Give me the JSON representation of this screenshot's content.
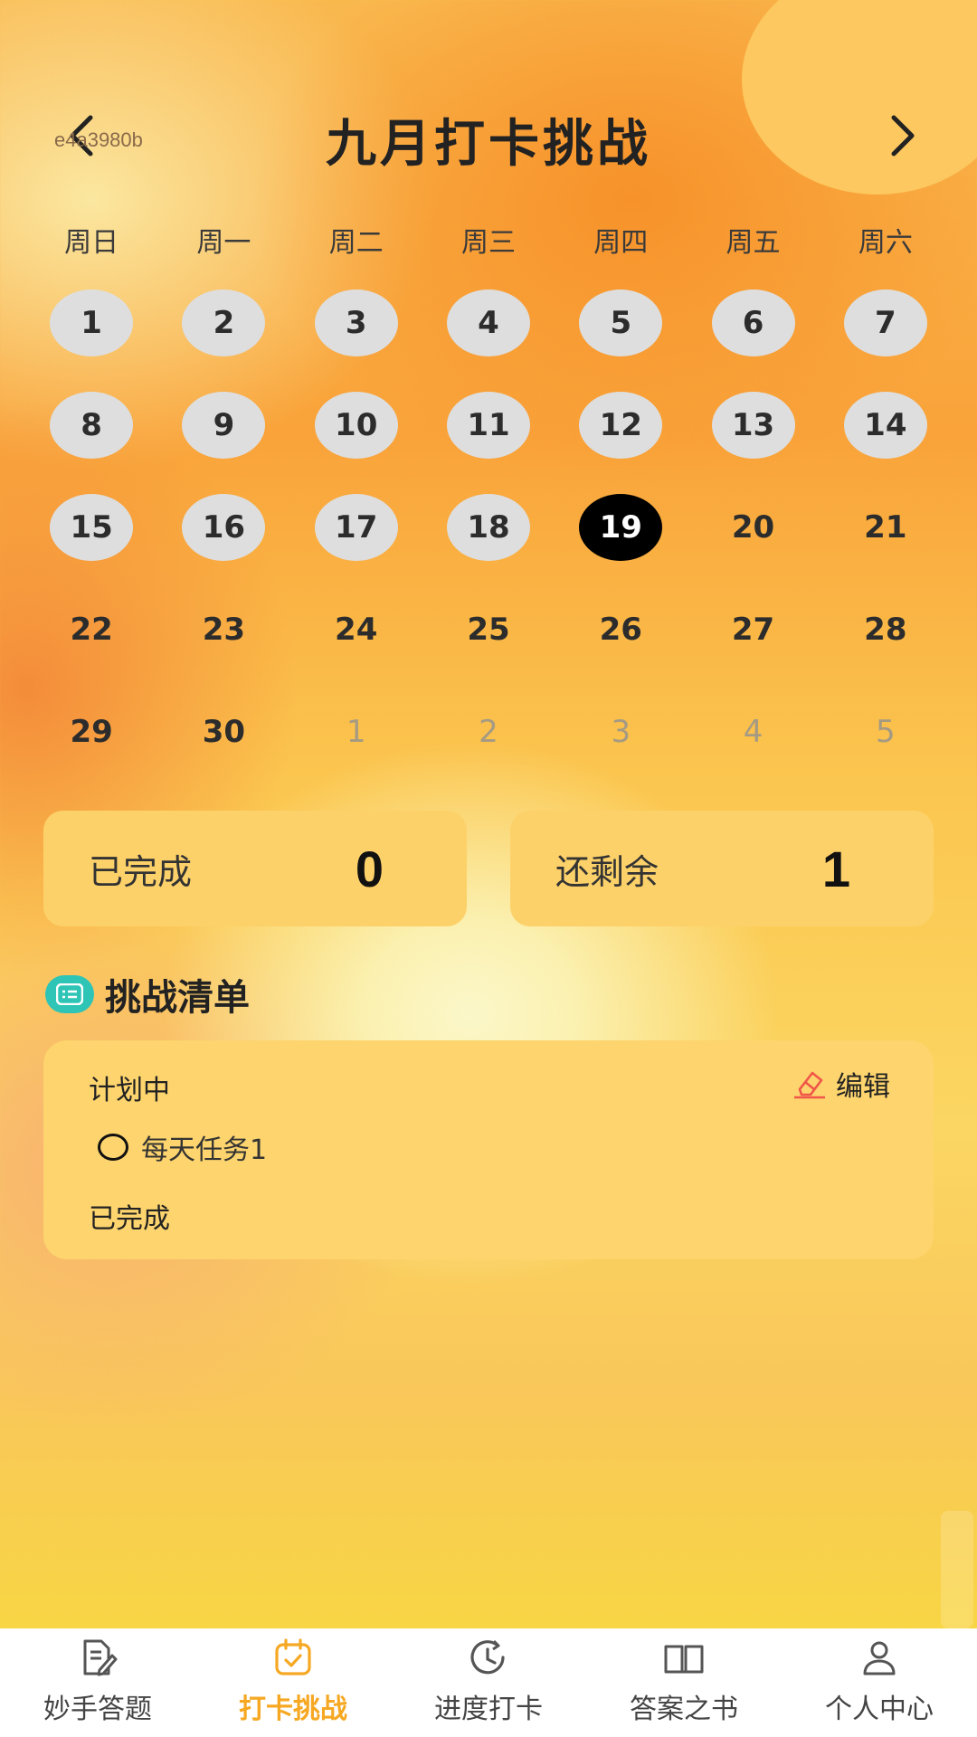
{
  "header": {
    "title": "九月打卡挑战",
    "user_id": "e4a3980b"
  },
  "weekdays": [
    "周日",
    "周一",
    "周二",
    "周三",
    "周四",
    "周五",
    "周六"
  ],
  "calendar": {
    "days": [
      "1",
      "2",
      "3",
      "4",
      "5",
      "6",
      "7",
      "8",
      "9",
      "10",
      "11",
      "12",
      "13",
      "14",
      "15",
      "16",
      "17",
      "18",
      "19",
      "20",
      "21",
      "22",
      "23",
      "24",
      "25",
      "26",
      "27",
      "28",
      "29",
      "30",
      "1",
      "2",
      "3",
      "4",
      "5"
    ],
    "today": "19"
  },
  "stats": {
    "completed_label": "已完成",
    "completed_value": "0",
    "remaining_label": "还剩余",
    "remaining_value": "1"
  },
  "checklist": {
    "title": "挑战清单",
    "planned_label": "计划中",
    "edit_label": "编辑",
    "task_label": "每天任务1",
    "done_label": "已完成"
  },
  "tabbar": {
    "items": [
      {
        "label": "妙手答题",
        "icon": "edit-paper-icon"
      },
      {
        "label": "打卡挑战",
        "icon": "calendar-check-icon"
      },
      {
        "label": "进度打卡",
        "icon": "clock-refresh-icon"
      },
      {
        "label": "答案之书",
        "icon": "book-icon"
      },
      {
        "label": "个人中心",
        "icon": "person-icon"
      }
    ],
    "active_index": 1
  },
  "colors": {
    "accent": "#f6a823",
    "card": "#fdd169",
    "today": "#000000",
    "past": "#dedede",
    "section_icon": "#2ec4b6",
    "edit_icon": "#f0564a"
  }
}
